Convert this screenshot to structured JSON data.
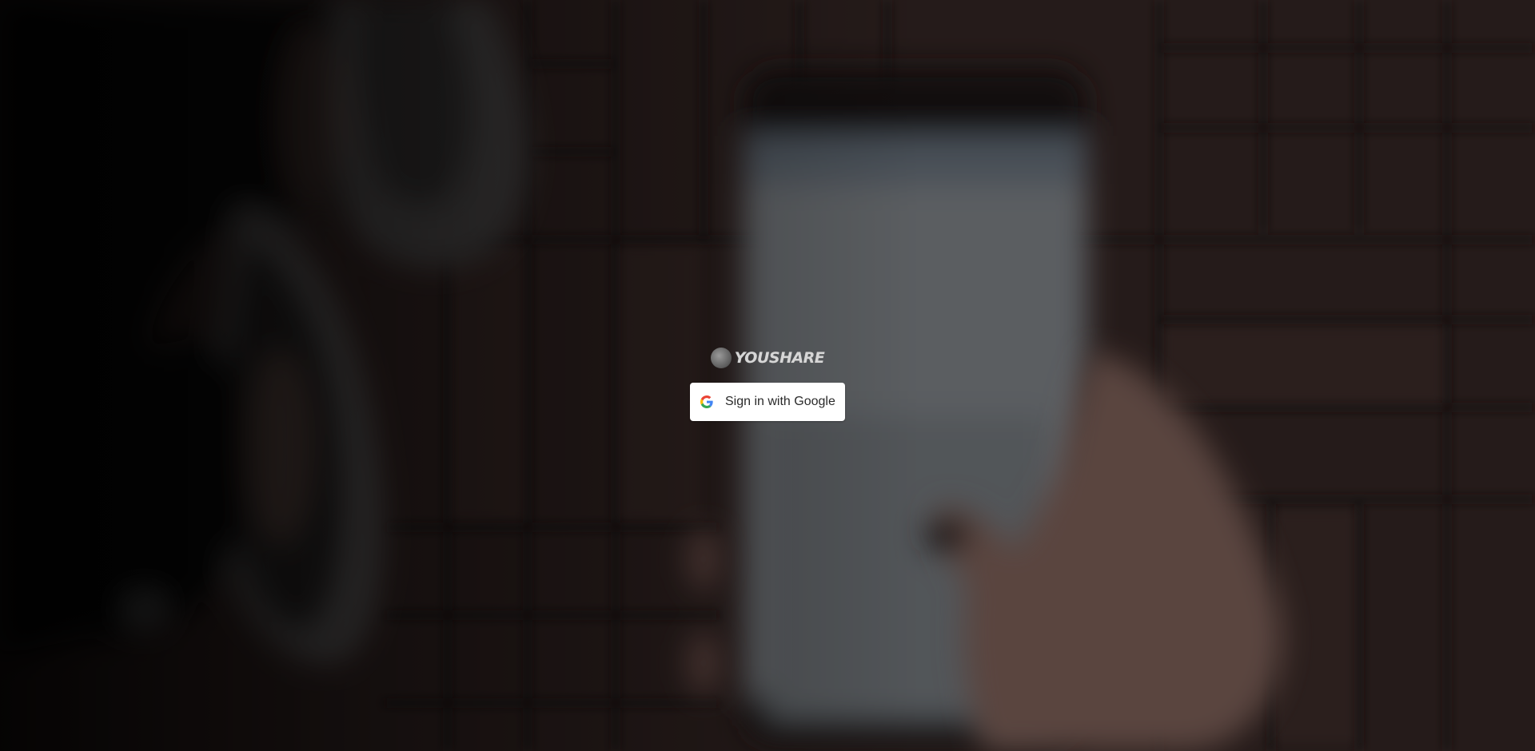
{
  "brand": {
    "logo_icon": "moon-logo-icon",
    "name": "YOUSHARE"
  },
  "signin": {
    "label": "Sign in with Google",
    "icon": "google-icon"
  },
  "colors": {
    "button_bg": "#ffffff",
    "button_text": "#2a2a2a",
    "background_tone": "#2b2020"
  }
}
